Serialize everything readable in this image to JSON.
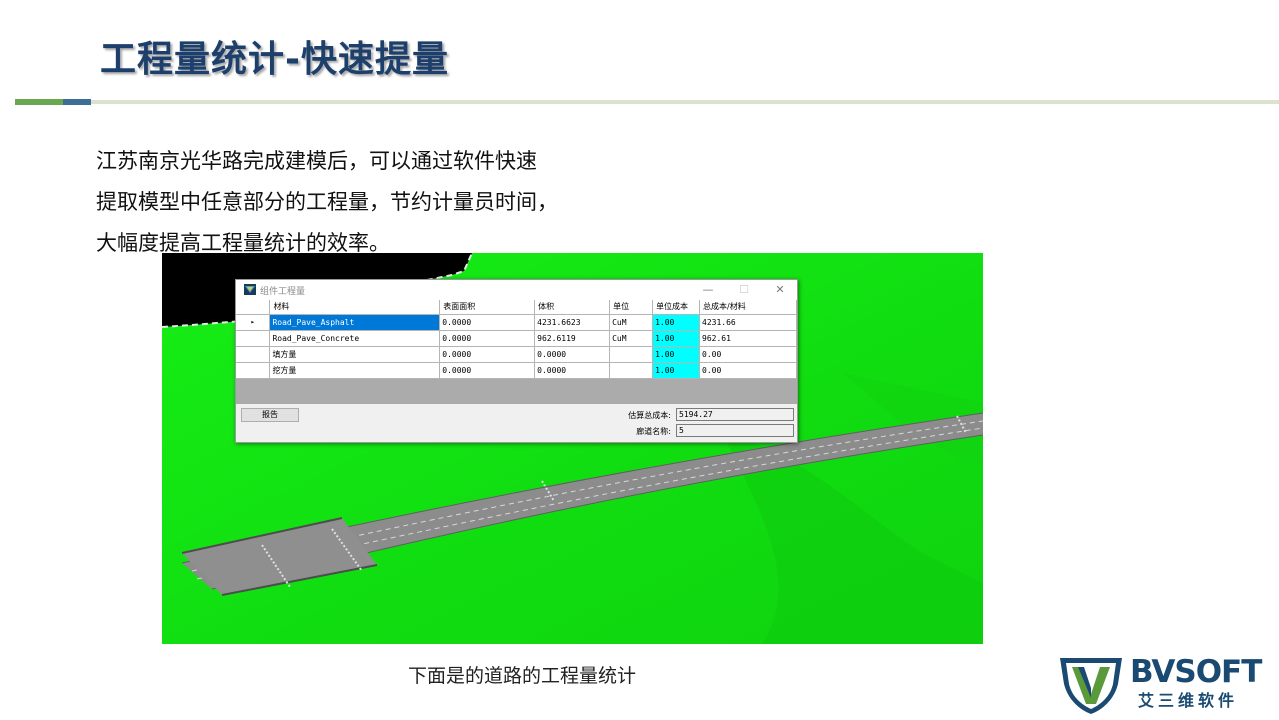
{
  "slide": {
    "title": "工程量统计-快速提量",
    "intro_lines": [
      "江苏南京光华路完成建模后，可以通过软件快速",
      "提取模型中任意部分的工程量，节约计量员时间，",
      "大幅度提高工程量统计的效率。"
    ],
    "caption": "下面是的道路的工程量统计"
  },
  "dialog": {
    "title": "组件工程量",
    "window_buttons": {
      "minimize": "—",
      "maximize": "☐",
      "close": "✕"
    },
    "columns": [
      "材料",
      "表面面积",
      "体积",
      "单位",
      "单位成本",
      "总成本/材料"
    ],
    "rows": [
      {
        "marker": "▸",
        "material": "Road_Pave_Asphalt",
        "surface_area": "0.0000",
        "volume": "4231.6623",
        "unit": "CuM",
        "unit_cost": "1.00",
        "total_cost": "4231.66"
      },
      {
        "marker": "",
        "material": "Road_Pave_Concrete",
        "surface_area": "0.0000",
        "volume": "962.6119",
        "unit": "CuM",
        "unit_cost": "1.00",
        "total_cost": "962.61"
      },
      {
        "marker": "",
        "material": "填方量",
        "surface_area": "0.0000",
        "volume": "0.0000",
        "unit": "",
        "unit_cost": "1.00",
        "total_cost": "0.00"
      },
      {
        "marker": "",
        "material": "挖方量",
        "surface_area": "0.0000",
        "volume": "0.0000",
        "unit": "",
        "unit_cost": "1.00",
        "total_cost": "0.00"
      }
    ],
    "report_button": "报告",
    "summary": {
      "estimated_total_label": "估算总成本:",
      "estimated_total_value": "5194.27",
      "corridor_name_label": "廊道名称:",
      "corridor_name_value": "5"
    }
  },
  "logo": {
    "brand": "BVSOFT",
    "subtitle": "艾三维软件"
  },
  "colors": {
    "title": "#1d3f6b",
    "terrain": "#12e312",
    "selection": "#0078d7",
    "unit_cost_cell": "#00ffff",
    "brand": "#1a4a72"
  }
}
